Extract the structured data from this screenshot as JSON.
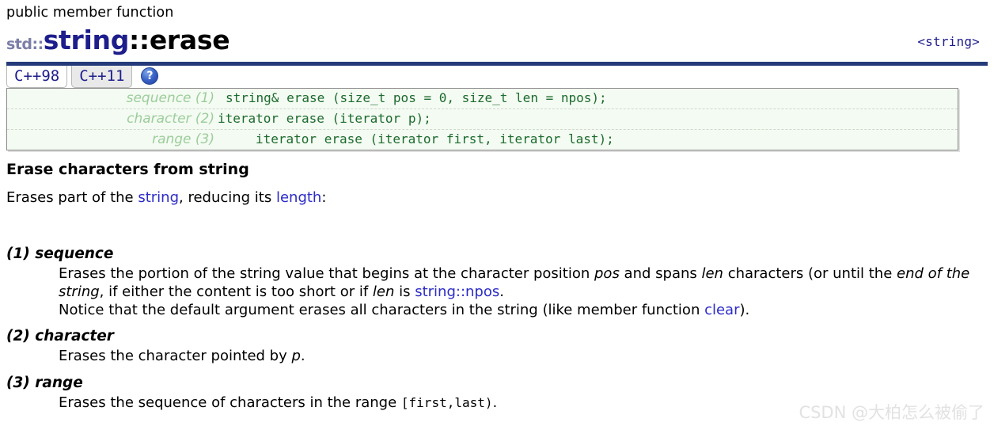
{
  "header": {
    "kind": "public member function",
    "title_namespace": "std::",
    "title_class": "string",
    "title_separator": "::",
    "title_function": "erase",
    "include_header": "<string>"
  },
  "tabs": {
    "items": [
      {
        "label": "C++98",
        "active": true
      },
      {
        "label": "C++11",
        "active": false
      }
    ],
    "help_icon_glyph": "?"
  },
  "signatures": [
    {
      "label": "sequence (1)",
      "name": "sequence",
      "number": "(1)",
      "code": "string& erase (size_t pos = 0, size_t len = npos);"
    },
    {
      "label": "character (2)",
      "name": "character",
      "number": "(2)",
      "code": "iterator erase (iterator p);"
    },
    {
      "label": "range (3)",
      "name": "range",
      "number": "(3)",
      "code": "iterator erase (iterator first, iterator last);"
    }
  ],
  "description": {
    "heading": "Erase characters from string",
    "intro_part1": "Erases part of the ",
    "intro_link1": "string",
    "intro_part2": ", reducing its ",
    "intro_link2": "length",
    "intro_part3": ":"
  },
  "variants": [
    {
      "title": "(1) sequence",
      "number": "(1)",
      "name": "sequence",
      "line1_a": "Erases the portion of the string value that begins at the character position ",
      "line1_em1": "pos",
      "line1_b": " and spans ",
      "line1_em2": "len",
      "line1_c": " characters (or until the ",
      "line1_em3": "end of the string",
      "line1_d": ", if either the content is too short or if ",
      "line1_em4": "len",
      "line1_e": " is ",
      "line1_link": "string::npos",
      "line1_f": ".",
      "line2_a": "Notice that the default argument erases all characters in the string (like member function ",
      "line2_link": "clear",
      "line2_b": ")."
    },
    {
      "title": "(2) character",
      "number": "(2)",
      "name": "character",
      "body_a": "Erases the character pointed by ",
      "body_em": "p",
      "body_b": "."
    },
    {
      "title": "(3) range",
      "number": "(3)",
      "name": "range",
      "body_a": "Erases the sequence of characters in the range ",
      "body_mono": "[first,last)",
      "body_b": "."
    }
  ],
  "watermark": {
    "text": "CSDN @大柏怎么被偷了"
  },
  "colors": {
    "rule": "#253b79",
    "link": "#2b2bc8",
    "code_green": "#1b6b2e",
    "label_green": "#9ccd9c",
    "sig_bg": "#f4fbf2",
    "title_class": "#1d1d8c",
    "namespace": "#7b7fa8",
    "watermark": "#e2e2e2"
  }
}
